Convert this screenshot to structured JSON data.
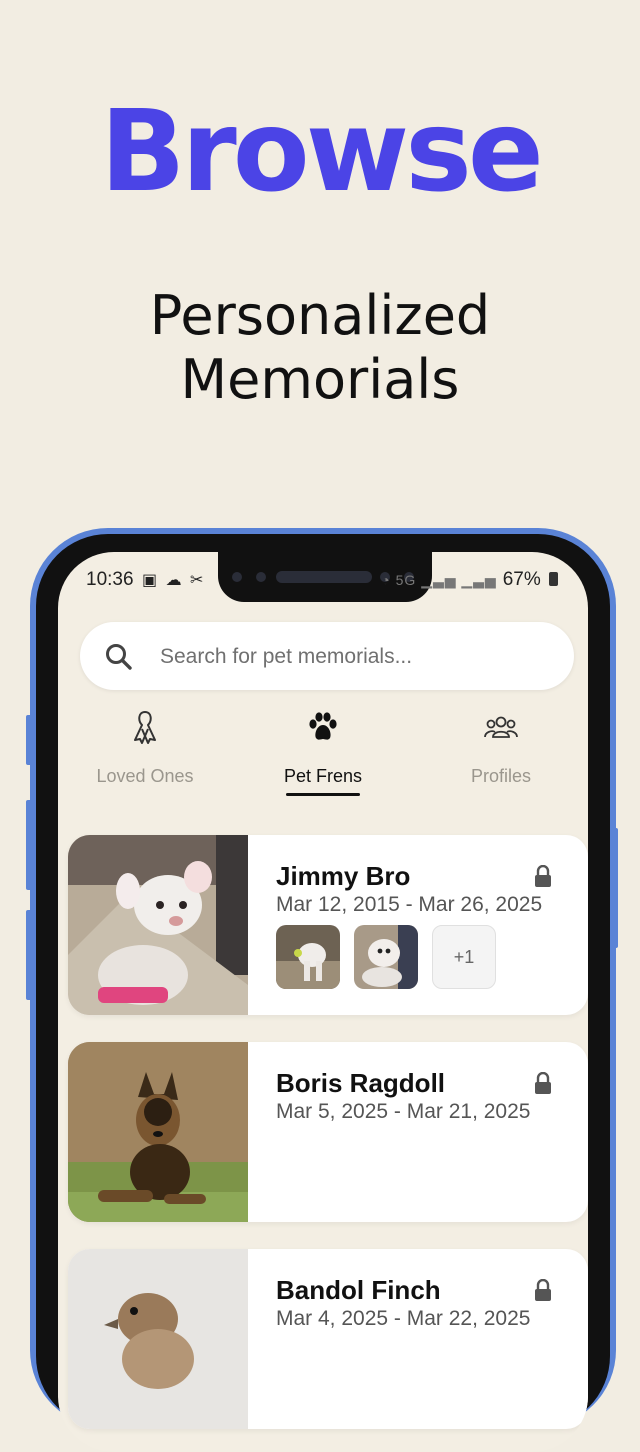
{
  "hero": {
    "title": "Browse",
    "subtitle_line1": "Personalized",
    "subtitle_line2": "Memorials"
  },
  "status_bar": {
    "time": "10:36",
    "battery": "67%"
  },
  "search": {
    "placeholder": "Search for pet memorials..."
  },
  "tabs": [
    {
      "label": "Loved Ones",
      "icon": "ribbon-icon",
      "active": false
    },
    {
      "label": "Pet Frens",
      "icon": "paw-icon",
      "active": true
    },
    {
      "label": "Profiles",
      "icon": "people-icon",
      "active": false
    }
  ],
  "memorials": [
    {
      "name": "Jimmy Bro",
      "dates": "Mar 12, 2015 - Mar 26, 2025",
      "locked": true,
      "extra_photos": "+1"
    },
    {
      "name": "Boris Ragdoll",
      "dates": "Mar 5, 2025 - Mar 21, 2025",
      "locked": true
    },
    {
      "name": "Bandol Finch",
      "dates": "Mar 4, 2025 - Mar 22, 2025",
      "locked": true
    }
  ],
  "colors": {
    "accent": "#4b44e6",
    "background": "#f2ede2",
    "phone_frame": "#5a83d6"
  }
}
